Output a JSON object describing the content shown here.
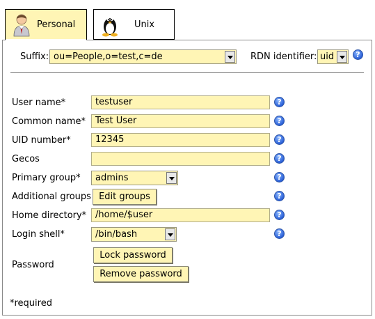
{
  "tabs": [
    {
      "label": "Personal",
      "icon": "user-avatar-icon",
      "active": true
    },
    {
      "label": "Unix",
      "icon": "tux-penguin-icon",
      "active": false
    }
  ],
  "suffix": {
    "label": "Suffix:",
    "value": "ou=People,o=test,c=de"
  },
  "rdn": {
    "label": "RDN identifier:",
    "value": "uid"
  },
  "fields": {
    "user_name": {
      "label": "User name*",
      "value": "testuser"
    },
    "common_name": {
      "label": "Common name*",
      "value": "Test User"
    },
    "uid_number": {
      "label": "UID number*",
      "value": "12345"
    },
    "gecos": {
      "label": "Gecos",
      "value": ""
    },
    "primary_group": {
      "label": "Primary group*",
      "value": "admins"
    },
    "additional_groups": {
      "label": "Additional groups",
      "button": "Edit groups"
    },
    "home_directory": {
      "label": "Home directory*",
      "value": "/home/$user"
    },
    "login_shell": {
      "label": "Login shell*",
      "value": "/bin/bash"
    },
    "password": {
      "label": "Password",
      "lock_button": "Lock password",
      "remove_button": "Remove password"
    }
  },
  "help_glyph": "?",
  "footnote": "*required",
  "colors": {
    "field_bg": "#fff5b5",
    "help_blue": "#2a5fd6"
  }
}
